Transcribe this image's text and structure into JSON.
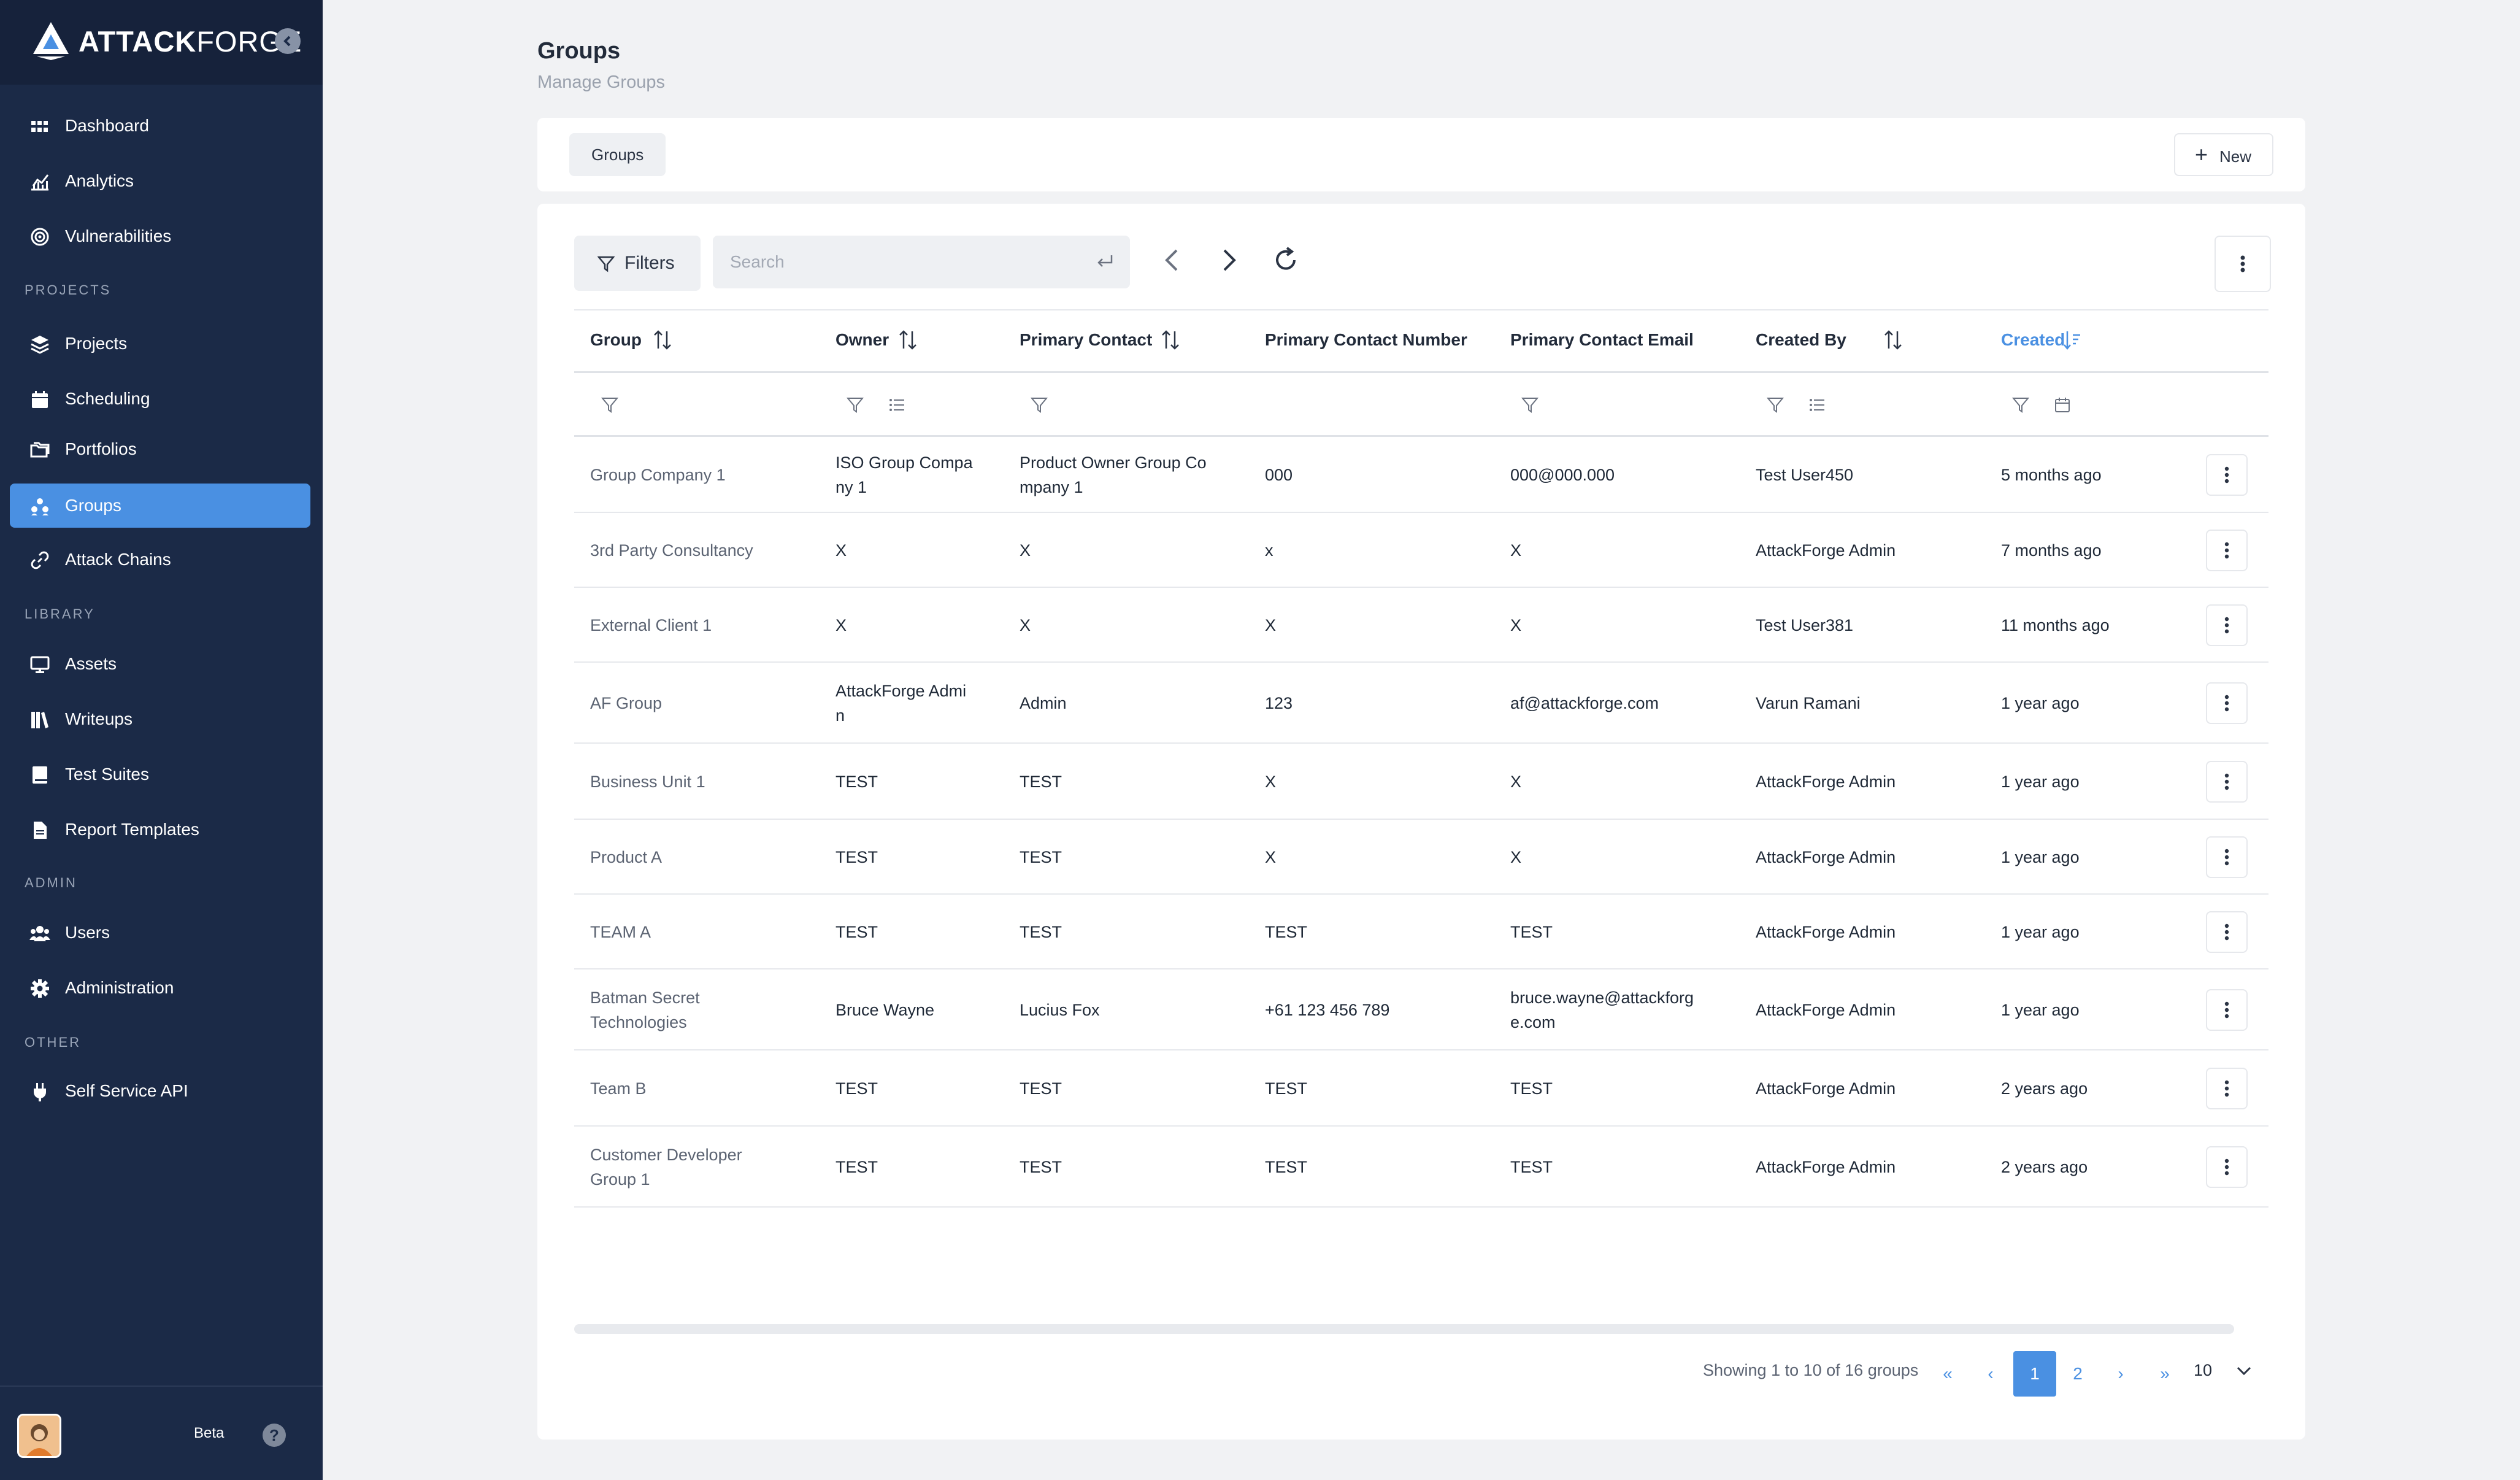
{
  "brand": {
    "name_bold": "ATTACK",
    "name_light": "FORGE"
  },
  "sidebar": {
    "items": [
      {
        "label": "Dashboard",
        "icon": "grid-icon"
      },
      {
        "label": "Analytics",
        "icon": "chart-icon"
      },
      {
        "label": "Vulnerabilities",
        "icon": "target-icon"
      },
      {
        "label": "Projects",
        "icon": "layers-icon"
      },
      {
        "label": "Scheduling",
        "icon": "calendar-icon"
      },
      {
        "label": "Portfolios",
        "icon": "folders-icon"
      },
      {
        "label": "Groups",
        "icon": "groups-icon",
        "active": true
      },
      {
        "label": "Attack Chains",
        "icon": "link-icon"
      },
      {
        "label": "Assets",
        "icon": "monitor-icon"
      },
      {
        "label": "Writeups",
        "icon": "books-icon"
      },
      {
        "label": "Test Suites",
        "icon": "book-icon"
      },
      {
        "label": "Report Templates",
        "icon": "file-icon"
      },
      {
        "label": "Users",
        "icon": "users-icon"
      },
      {
        "label": "Administration",
        "icon": "gear-icon"
      },
      {
        "label": "Self Service API",
        "icon": "plug-icon"
      }
    ],
    "sections": {
      "projects": "PROJECTS",
      "library": "LIBRARY",
      "admin": "ADMIN",
      "other": "OTHER"
    },
    "footer": {
      "beta_label": "Beta",
      "help_label": "?"
    }
  },
  "header": {
    "title": "Groups",
    "subtitle": "Manage Groups"
  },
  "tabs": {
    "groups_label": "Groups",
    "new_label": "New"
  },
  "toolbar": {
    "filters_label": "Filters",
    "search_placeholder": "Search"
  },
  "table": {
    "columns": [
      "Group",
      "Owner",
      "Primary Contact",
      "Primary Contact Number",
      "Primary Contact Email",
      "Created By",
      "Created"
    ],
    "sorted_column": "Created",
    "rows": [
      {
        "group": "Group Company 1",
        "owner": [
          "ISO Group Compa",
          "ny 1"
        ],
        "contact": [
          "Product Owner Group Co",
          "mpany 1"
        ],
        "number": "000",
        "email": [
          "000@000.000"
        ],
        "created_by": "Test User450",
        "created": "5 months ago"
      },
      {
        "group": "3rd Party Consultancy",
        "owner": [
          "X"
        ],
        "contact": [
          "X"
        ],
        "number": "x",
        "email": [
          "X"
        ],
        "created_by": "AttackForge Admin",
        "created": "7 months ago"
      },
      {
        "group": "External Client 1",
        "owner": [
          "X"
        ],
        "contact": [
          "X"
        ],
        "number": "X",
        "email": [
          "X"
        ],
        "created_by": "Test User381",
        "created": "11 months ago"
      },
      {
        "group": "AF Group",
        "owner": [
          "AttackForge Admi",
          "n"
        ],
        "contact": [
          "Admin"
        ],
        "number": "123",
        "email": [
          "af@attackforge.com"
        ],
        "created_by": "Varun Ramani",
        "created": "1 year ago"
      },
      {
        "group": "Business Unit 1",
        "owner": [
          "TEST"
        ],
        "contact": [
          "TEST"
        ],
        "number": "X",
        "email": [
          "X"
        ],
        "created_by": "AttackForge Admin",
        "created": "1 year ago"
      },
      {
        "group": "Product A",
        "owner": [
          "TEST"
        ],
        "contact": [
          "TEST"
        ],
        "number": "X",
        "email": [
          "X"
        ],
        "created_by": "AttackForge Admin",
        "created": "1 year ago"
      },
      {
        "group": "TEAM A",
        "owner": [
          "TEST"
        ],
        "contact": [
          "TEST"
        ],
        "number": "TEST",
        "email": [
          "TEST"
        ],
        "created_by": "AttackForge Admin",
        "created": "1 year ago"
      },
      {
        "group": [
          "Batman Secret",
          "Technologies"
        ],
        "owner": [
          "Bruce Wayne"
        ],
        "contact": [
          "Lucius Fox"
        ],
        "number": "+61 123 456 789",
        "email": [
          "bruce.wayne@attackforg",
          "e.com"
        ],
        "created_by": "AttackForge Admin",
        "created": "1 year ago"
      },
      {
        "group": "Team B",
        "owner": [
          "TEST"
        ],
        "contact": [
          "TEST"
        ],
        "number": "TEST",
        "email": [
          "TEST"
        ],
        "created_by": "AttackForge Admin",
        "created": "2 years ago"
      },
      {
        "group": [
          "Customer Developer",
          "Group 1"
        ],
        "owner": [
          "TEST"
        ],
        "contact": [
          "TEST"
        ],
        "number": "TEST",
        "email": [
          "TEST"
        ],
        "created_by": "AttackForge Admin",
        "created": "2 years ago"
      }
    ]
  },
  "pagination": {
    "summary": "Showing 1 to 10 of 16 groups",
    "pages": [
      "1",
      "2"
    ],
    "current": "1",
    "per_page": "10",
    "first": "«",
    "prev": "‹",
    "next": "›",
    "last": "»"
  },
  "colors": {
    "sidebar_bg": "#1b2a47",
    "accent": "#4a90e2",
    "page_bg": "#f1f2f4"
  }
}
